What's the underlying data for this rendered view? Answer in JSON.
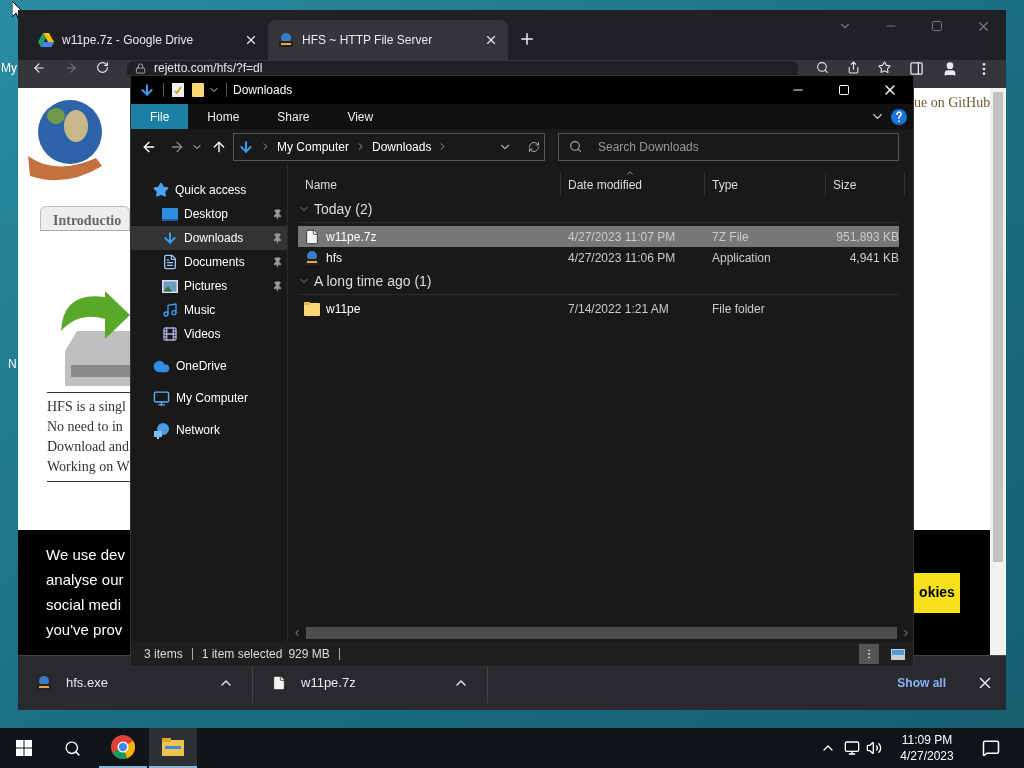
{
  "desktop": {
    "icon_labels": [
      "My",
      "N"
    ]
  },
  "browser": {
    "tabs": [
      {
        "title": "w11pe.7z - Google Drive",
        "kind": "drive",
        "selected": false
      },
      {
        "title": "HFS ~ HTTP File Server",
        "kind": "hfs",
        "selected": true
      }
    ],
    "url": "rejetto.com/hfs/?f=dl",
    "page": {
      "nav_tab": "Introductio",
      "github_link": "ue on GitHub",
      "intro_lines": [
        "HFS is a singl",
        "No need to in",
        "Download and",
        "Working on W"
      ],
      "cookie_lines": [
        "We use dev",
        "analyse our",
        "social medi",
        "you've prov"
      ],
      "cookie_button": "okies"
    },
    "downloads": [
      {
        "name": "hfs.exe",
        "kind": "app"
      },
      {
        "name": "w11pe.7z",
        "kind": "file"
      }
    ],
    "show_all": "Show all"
  },
  "explorer": {
    "title": "Downloads",
    "ribbon_tabs": [
      {
        "label": "File",
        "selected": true
      },
      {
        "label": "Home",
        "selected": false
      },
      {
        "label": "Share",
        "selected": false
      },
      {
        "label": "View",
        "selected": false
      }
    ],
    "breadcrumb": [
      "My Computer",
      "Downloads"
    ],
    "search_placeholder": "Search Downloads",
    "nav": [
      {
        "label": "Quick access",
        "kind": "star",
        "selected": false,
        "children": [
          {
            "label": "Desktop",
            "kind": "desktop",
            "pinned": true,
            "selected": false
          },
          {
            "label": "Downloads",
            "kind": "download",
            "pinned": true,
            "selected": true
          },
          {
            "label": "Documents",
            "kind": "document",
            "pinned": true,
            "selected": false
          },
          {
            "label": "Pictures",
            "kind": "pictures",
            "pinned": true,
            "selected": false
          },
          {
            "label": "Music",
            "kind": "music",
            "pinned": false,
            "selected": false
          },
          {
            "label": "Videos",
            "kind": "videos",
            "pinned": false,
            "selected": false
          }
        ]
      },
      {
        "label": "OneDrive",
        "kind": "cloud",
        "selected": false
      },
      {
        "label": "My Computer",
        "kind": "computer",
        "selected": false
      },
      {
        "label": "Network",
        "kind": "network",
        "selected": false
      }
    ],
    "columns": [
      {
        "label": "Name",
        "sorted": false
      },
      {
        "label": "Date modified",
        "sorted": true
      },
      {
        "label": "Type",
        "sorted": false
      },
      {
        "label": "Size",
        "sorted": false
      }
    ],
    "groups": [
      {
        "label": "Today (2)",
        "expanded": true,
        "files": [
          {
            "name": "w11pe.7z",
            "date": "4/27/2023 11:07 PM",
            "type": "7Z File",
            "size": "951,893 KB",
            "kind": "file",
            "selected": true
          },
          {
            "name": "hfs",
            "date": "4/27/2023 11:06 PM",
            "type": "Application",
            "size": "4,941 KB",
            "kind": "app",
            "selected": false
          }
        ]
      },
      {
        "label": "A long time ago (1)",
        "expanded": true,
        "files": [
          {
            "name": "w11pe",
            "date": "7/14/2022 1:21 AM",
            "type": "File folder",
            "kind": "folder",
            "selected": false
          }
        ]
      }
    ],
    "status": {
      "items": "3 items",
      "selection": "1 item selected",
      "selection_size": "929 MB"
    }
  },
  "taskbar": {
    "apps": [
      {
        "kind": "chrome",
        "selected": false
      },
      {
        "kind": "explorer",
        "selected": true
      }
    ],
    "time": "11:09 PM",
    "date": "4/27/2023"
  }
}
